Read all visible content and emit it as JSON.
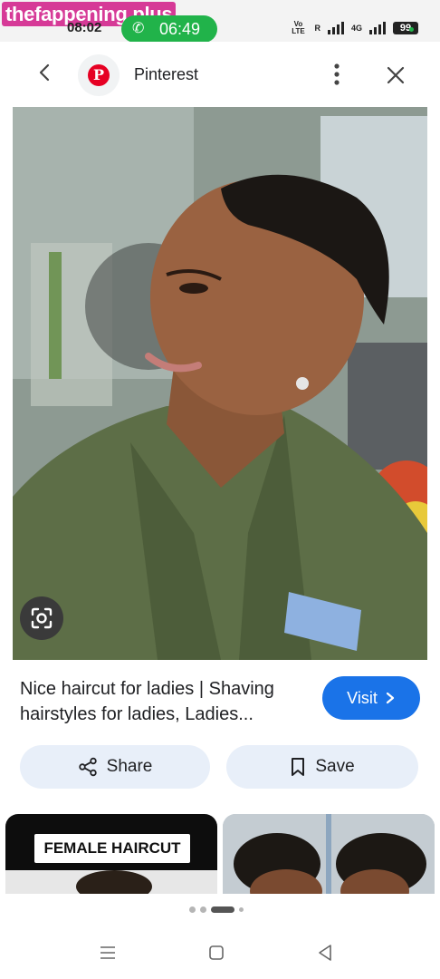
{
  "status_bar": {
    "watermark": "thefappening.plus",
    "time": "08:02",
    "call_timer": "06:49",
    "volte": "Vo LTE",
    "roaming": "R",
    "network": "4G",
    "battery": "99",
    "call_pill_color": "#21b34a"
  },
  "header": {
    "site_name": "Pinterest",
    "logo_letter": "P",
    "icons": [
      "back-arrow-icon",
      "pinterest-logo",
      "more-vert-icon",
      "close-icon"
    ]
  },
  "result": {
    "caption": "Nice haircut for ladies | Shaving hairstyles for ladies, Ladies...",
    "visit_label": "Visit",
    "share_label": "Share",
    "save_label": "Save",
    "accent_color": "#1a73e8"
  },
  "related": {
    "first_label": "FEMALE HAIRCUT"
  },
  "navigation": {
    "icons": [
      "recent-apps-icon",
      "home-icon",
      "back-icon"
    ]
  }
}
